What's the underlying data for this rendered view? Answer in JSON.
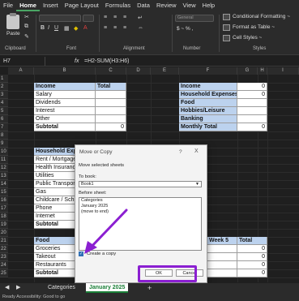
{
  "menu": [
    "File",
    "Home",
    "Insert",
    "Page Layout",
    "Formulas",
    "Data",
    "Review",
    "View",
    "Help"
  ],
  "ribbon": {
    "paste": "Paste",
    "groups": [
      "Clipboard",
      "Font",
      "Alignment",
      "Number",
      "Styles"
    ],
    "number_format": "General",
    "number_symbols": "$ ~ % ,",
    "styles": [
      "Conditional Formatting ~",
      "Format as Table ~",
      "Cell Styles ~"
    ]
  },
  "formula_bar": {
    "name": "H7",
    "fx": "fx",
    "formula": "=H2-SUM(H3:H6)"
  },
  "columns": [
    "A",
    "B",
    "C",
    "D",
    "E",
    "F",
    "G",
    "H",
    "I"
  ],
  "rows": [
    "1",
    "2",
    "3",
    "4",
    "5",
    "6",
    "7",
    "8",
    "9",
    "10",
    "11",
    "12",
    "13",
    "14",
    "15",
    "16",
    "17",
    "18",
    "19",
    "20",
    "21",
    "22",
    "23",
    "24",
    "25"
  ],
  "table1": {
    "h1": "Income",
    "h2": "Total",
    "rows": [
      "Salary",
      "Dividends",
      "Interest",
      "Other",
      "Subtotal"
    ],
    "subtotal": "0"
  },
  "table2": {
    "rows": [
      "Income",
      "Household Expenses",
      "Food",
      "Hobbies/Leisure",
      "Banking",
      "Monthly Total"
    ],
    "values": [
      "0",
      "0",
      "",
      "",
      "",
      "0"
    ]
  },
  "table3": {
    "header": "Household Expe",
    "rows": [
      "Rent / Mortgage",
      "Health Insurance",
      "Utilities",
      "Public Transport",
      "Gas",
      "Childcare / Sch",
      "Phone",
      "Internet",
      "Subtotal"
    ]
  },
  "table4": {
    "header": "Food",
    "rows": [
      "Groceries",
      "Takeout",
      "Restaurants",
      "Subtotal"
    ],
    "week5": "Week 5",
    "total": "Total",
    "totals": [
      "0",
      "0",
      "0",
      "0"
    ]
  },
  "dialog": {
    "title": "Move or Copy",
    "help": "?",
    "close": "X",
    "move_text": "Move selected sheets",
    "to_book": "To book:",
    "book": "Book1",
    "before": "Before sheet:",
    "sheets": [
      "Categories",
      "January 2025",
      "(move to end)"
    ],
    "create_copy": "Create a copy",
    "ok": "OK",
    "cancel": "Cancel"
  },
  "tabs": {
    "first": "Categories",
    "active": "January 2025",
    "add": "+"
  },
  "status": "Ready   Accessibility: Good to go",
  "colors": {
    "accent": "#8b1fd1",
    "header_fill": "#bcd2ee",
    "excel_green": "#1a7f37"
  }
}
